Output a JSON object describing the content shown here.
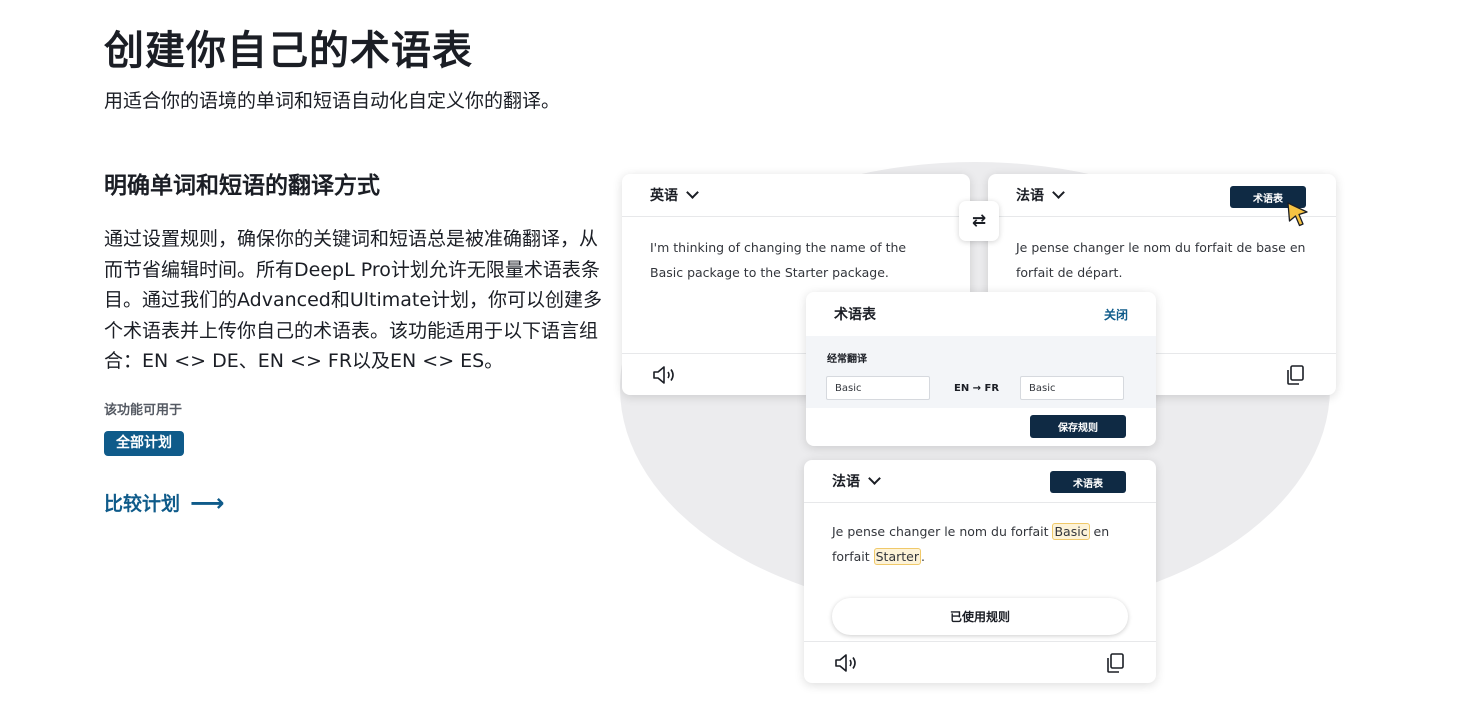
{
  "hero": {
    "title": "创建你自己的术语表",
    "subtitle": "用适合你的语境的单词和短语自动化自定义你的翻译。"
  },
  "feature": {
    "title": "明确单词和短语的翻译方式",
    "body": "通过设置规则，确保你的关键词和短语总是被准确翻译，从而节省编辑时间。所有DeepL Pro计划允许无限量术语表条目。通过我们的Advanced和Ultimate计划，你可以创建多个术语表并上传你自己的术语表。该功能适用于以下语言组合：EN <> DE、EN <> FR以及EN <> ES。",
    "available_label": "该功能可用于",
    "plan_badge": "全部计划",
    "compare_link": "比较计划",
    "compare_arrow": "⟶"
  },
  "source_card": {
    "language": "英语",
    "text": "I'm thinking of changing the name of the Basic package to the Starter package."
  },
  "swap_icon_glyph": "⇄",
  "target_card": {
    "language": "法语",
    "glossary_button": "术语表",
    "text": "Je pense changer le nom du forfait de base en forfait de départ."
  },
  "glossary_panel": {
    "title": "术语表",
    "close": "关闭",
    "section_label": "经常翻译",
    "source_value": "Basic",
    "pair_label": "EN → FR",
    "target_value": "Basic",
    "save_button": "保存规则"
  },
  "result_card": {
    "language": "法语",
    "glossary_button": "术语表",
    "text_1": "Je pense changer le nom du forfait ",
    "highlight_1": "Basic",
    "text_2": " en forfait ",
    "highlight_2": "Starter",
    "text_3": ".",
    "applied_button": "已使用规则"
  },
  "colors": {
    "accent_blue": "#0f5b8a",
    "dark_navy": "#0f2a44",
    "cursor_yellow": "#f6c343",
    "highlight_bg": "#fdf3d8"
  }
}
